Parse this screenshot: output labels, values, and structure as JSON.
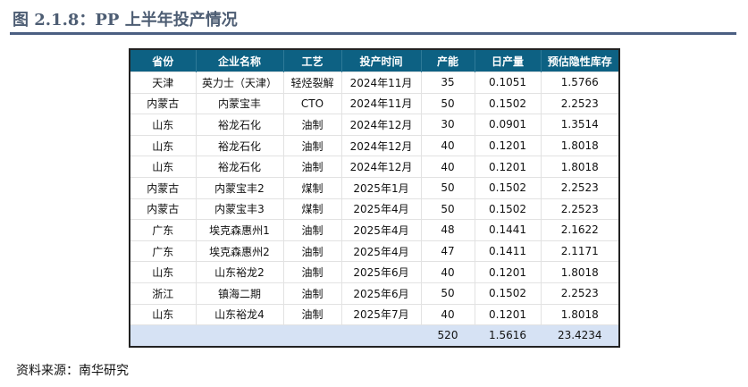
{
  "title": "图 2.1.8：PP 上半年投产情况",
  "columns": [
    "省份",
    "企业名称",
    "工艺",
    "投产时间",
    "产能",
    "日产量",
    "预估隐性库存"
  ],
  "rows": [
    [
      "天津",
      "英力士（天津）",
      "轻烃裂解",
      "2024年11月",
      "35",
      "0.1051",
      "1.5766"
    ],
    [
      "内蒙古",
      "内蒙宝丰",
      "CTO",
      "2024年11月",
      "50",
      "0.1502",
      "2.2523"
    ],
    [
      "山东",
      "裕龙石化",
      "油制",
      "2024年12月",
      "30",
      "0.0901",
      "1.3514"
    ],
    [
      "山东",
      "裕龙石化",
      "油制",
      "2024年12月",
      "40",
      "0.1201",
      "1.8018"
    ],
    [
      "山东",
      "裕龙石化",
      "油制",
      "2024年12月",
      "40",
      "0.1201",
      "1.8018"
    ],
    [
      "内蒙古",
      "内蒙宝丰2",
      "煤制",
      "2025年1月",
      "50",
      "0.1502",
      "2.2523"
    ],
    [
      "内蒙古",
      "内蒙宝丰3",
      "煤制",
      "2025年4月",
      "50",
      "0.1502",
      "2.2523"
    ],
    [
      "广东",
      "埃克森惠州1",
      "油制",
      "2025年4月",
      "48",
      "0.1441",
      "2.1622"
    ],
    [
      "广东",
      "埃克森惠州2",
      "油制",
      "2025年4月",
      "47",
      "0.1411",
      "2.1171"
    ],
    [
      "山东",
      "山东裕龙2",
      "油制",
      "2025年6月",
      "40",
      "0.1201",
      "1.8018"
    ],
    [
      "浙江",
      "镇海二期",
      "油制",
      "2025年6月",
      "50",
      "0.1502",
      "2.2523"
    ],
    [
      "山东",
      "山东裕龙4",
      "油制",
      "2025年7月",
      "40",
      "0.1201",
      "1.8018"
    ]
  ],
  "total": [
    "",
    "",
    "",
    "",
    "520",
    "1.5616",
    "23.4234"
  ],
  "source": "资料来源：南华研究"
}
